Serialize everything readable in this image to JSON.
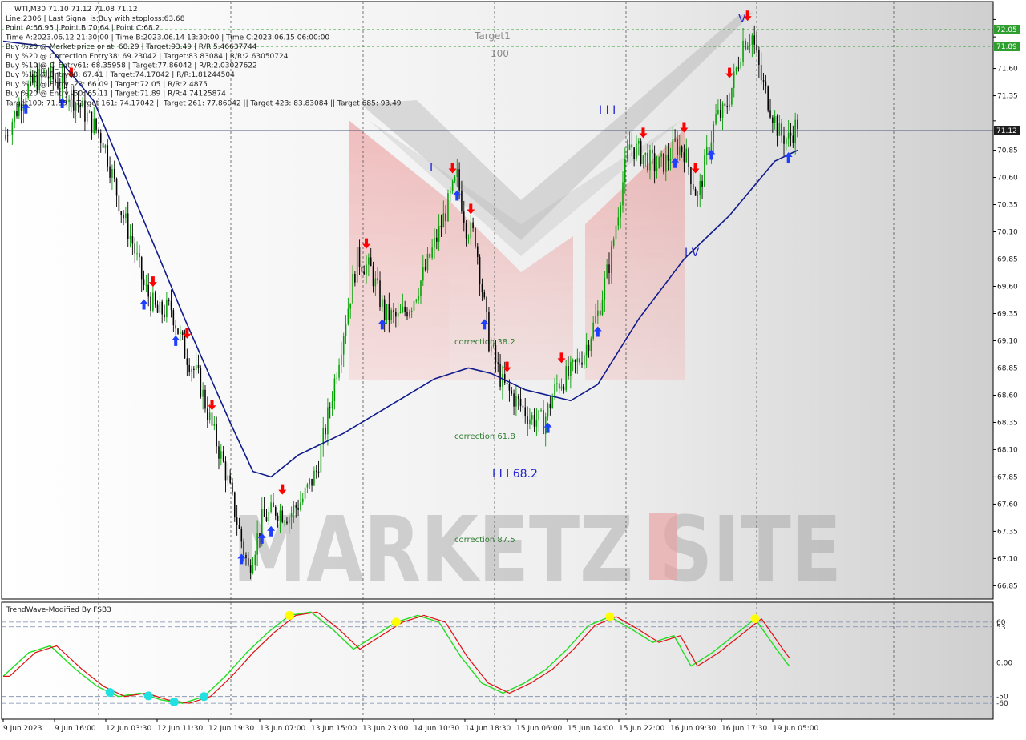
{
  "header": {
    "symbol_line": "WTI,M30  71.10 71.12 71.08 71.12",
    "info_lines": [
      "Line:2306 | Last Signal is:Buy with stoploss:63.68",
      "Point A:66.95 | Point B:70.64 | Point C:68.2",
      "Time A:2023.06.12 21:30:00 | Time B:2023.06.14 13:30:00 | Time C:2023.06.15 06:00:00",
      "Buy %20 @ Market price or at: 68.29 | Target:93.49 | R/R:5.46637744",
      "Buy %20 @ Correction Entry38: 69.23042 | Target:83.83084 | R/R:2.63050724",
      "Buy %10 @ C_Entry61: 68.35958 | Target:77.86042 | R/R:2.03027622",
      "Buy %10 @ Entry88: 67.41 | Target:74.17042 | R/R:1.81244504",
      "Buy %10 @ Entry -23: 66.09 | Target:72.05 | R/R:2.4875",
      "Buy %20 @ Entry -50: 65.11 | Target:71.89 | R/R:4.74125874",
      "Target100: 71.89 || Target 161: 74.17042 || Target 261: 77.86042 || Target 423: 83.83084 || Target 685: 93.49"
    ]
  },
  "annotations": {
    "target_label": "Target1",
    "target_value": "100",
    "corrections": [
      "correction 38.2",
      "correction 61.8",
      "correction 87.5"
    ],
    "wave_labels": [
      "I",
      "I I I",
      "I V",
      "V",
      "I I I 68.2"
    ],
    "watermark": "MARKETZ SITE"
  },
  "price_axis": {
    "ticks": [
      "72.05",
      "71.89",
      "71.60",
      "71.35",
      "71.12",
      "70.85",
      "70.60",
      "70.35",
      "70.10",
      "69.85",
      "69.60",
      "69.35",
      "69.10",
      "68.85",
      "68.60",
      "68.35",
      "68.10",
      "67.85",
      "67.60",
      "67.35",
      "67.10",
      "66.85"
    ],
    "current_price": "71.12",
    "target_tags": [
      "72.05",
      "71.89"
    ]
  },
  "time_axis": {
    "labels": [
      "9 Jun 2023",
      "9 Jun 16:00",
      "12 Jun 03:30",
      "12 Jun 11:30",
      "12 Jun 19:30",
      "13 Jun 07:00",
      "13 Jun 15:00",
      "13 Jun 23:00",
      "14 Jun 10:30",
      "14 Jun 18:30",
      "15 Jun 06:00",
      "15 Jun 14:00",
      "15 Jun 22:00",
      "16 Jun 09:30",
      "16 Jun 17:30",
      "19 Jun 05:00"
    ]
  },
  "indicator": {
    "title": "TrendWave-Modified By FSB3",
    "levels": [
      "60",
      "53",
      "0.00",
      "-50",
      "-60"
    ]
  },
  "colors": {
    "up_candle": "#00a000",
    "down_candle": "#000000",
    "ma_line": "#101c8c",
    "buy_arrow": "#1f3fff",
    "sell_arrow": "#ff0000",
    "target_line": "#2ca02c",
    "osc_green": "#22dd22",
    "osc_red": "#dd1111",
    "osc_yellow_dot": "#ffff00",
    "osc_cyan_dot": "#22e0e0"
  },
  "chart_data": {
    "type": "candlestick",
    "symbol": "WTI",
    "timeframe": "M30",
    "ylim": [
      66.75,
      72.2
    ],
    "price_ticks": [
      72.05,
      71.89,
      71.6,
      71.35,
      71.12,
      70.85,
      70.6,
      70.35,
      70.1,
      69.85,
      69.6,
      69.35,
      69.1,
      68.85,
      68.6,
      68.35,
      68.1,
      67.85,
      67.6,
      67.35,
      67.1,
      66.85
    ],
    "target_levels": [
      72.05,
      71.89
    ],
    "current_price": 71.12,
    "close_path": [
      [
        0,
        70.95
      ],
      [
        10,
        71.4
      ],
      [
        18,
        71.55
      ],
      [
        26,
        71.45
      ],
      [
        34,
        71.25
      ],
      [
        44,
        70.95
      ],
      [
        52,
        70.3
      ],
      [
        57,
        70.0
      ],
      [
        62,
        69.6
      ],
      [
        68,
        69.35
      ],
      [
        74,
        69.4
      ],
      [
        80,
        69.0
      ],
      [
        86,
        68.75
      ],
      [
        92,
        68.3
      ],
      [
        98,
        67.9
      ],
      [
        104,
        67.35
      ],
      [
        108,
        67.0
      ],
      [
        114,
        67.45
      ],
      [
        120,
        67.55
      ],
      [
        126,
        67.5
      ],
      [
        132,
        67.65
      ],
      [
        138,
        67.9
      ],
      [
        144,
        68.5
      ],
      [
        150,
        69.2
      ],
      [
        156,
        69.85
      ],
      [
        162,
        69.75
      ],
      [
        168,
        69.35
      ],
      [
        174,
        69.3
      ],
      [
        180,
        69.45
      ],
      [
        186,
        69.75
      ],
      [
        192,
        70.1
      ],
      [
        196,
        70.35
      ],
      [
        200,
        70.6
      ],
      [
        204,
        70.15
      ],
      [
        208,
        70.05
      ],
      [
        214,
        69.1
      ],
      [
        220,
        68.7
      ],
      [
        226,
        68.55
      ],
      [
        232,
        68.4
      ],
      [
        238,
        68.35
      ],
      [
        244,
        68.7
      ],
      [
        250,
        68.8
      ],
      [
        256,
        69.0
      ],
      [
        262,
        69.35
      ],
      [
        268,
        69.9
      ],
      [
        272,
        70.45
      ],
      [
        276,
        70.9
      ],
      [
        282,
        70.8
      ],
      [
        288,
        70.7
      ],
      [
        292,
        70.75
      ],
      [
        296,
        70.9
      ],
      [
        300,
        70.85
      ],
      [
        306,
        70.4
      ],
      [
        310,
        70.8
      ],
      [
        314,
        71.15
      ],
      [
        318,
        71.2
      ],
      [
        322,
        71.5
      ],
      [
        326,
        71.85
      ],
      [
        330,
        71.9
      ],
      [
        334,
        71.5
      ],
      [
        338,
        71.25
      ],
      [
        342,
        71.0
      ],
      [
        346,
        70.95
      ],
      [
        350,
        71.1
      ]
    ],
    "ma_path": [
      [
        0,
        71.85
      ],
      [
        20,
        71.8
      ],
      [
        40,
        71.3
      ],
      [
        60,
        70.3
      ],
      [
        80,
        69.3
      ],
      [
        100,
        68.35
      ],
      [
        110,
        67.9
      ],
      [
        118,
        67.85
      ],
      [
        130,
        68.05
      ],
      [
        150,
        68.25
      ],
      [
        170,
        68.5
      ],
      [
        190,
        68.75
      ],
      [
        205,
        68.85
      ],
      [
        215,
        68.8
      ],
      [
        230,
        68.65
      ],
      [
        250,
        68.55
      ],
      [
        262,
        68.7
      ],
      [
        280,
        69.3
      ],
      [
        300,
        69.85
      ],
      [
        320,
        70.25
      ],
      [
        340,
        70.75
      ],
      [
        350,
        70.85
      ]
    ],
    "buy_signals": [
      10,
      26,
      62,
      76,
      105,
      114,
      118,
      167,
      200,
      212,
      240,
      262,
      296,
      312,
      346
    ],
    "sell_signals": [
      30,
      66,
      81,
      92,
      123,
      160,
      198,
      206,
      222,
      246,
      282,
      300,
      305,
      320,
      328
    ],
    "point_a": 66.95,
    "point_b": 70.64,
    "point_c": 68.2,
    "oscillator": {
      "ylim": [
        -80,
        80
      ],
      "levels": [
        60,
        53,
        0,
        -50,
        -60
      ],
      "main": [
        [
          0,
          -20
        ],
        [
          12,
          15
        ],
        [
          22,
          25
        ],
        [
          34,
          -10
        ],
        [
          44,
          -35
        ],
        [
          54,
          -50
        ],
        [
          64,
          -45
        ],
        [
          74,
          -55
        ],
        [
          84,
          -60
        ],
        [
          94,
          -50
        ],
        [
          104,
          -20
        ],
        [
          114,
          15
        ],
        [
          124,
          45
        ],
        [
          134,
          70
        ],
        [
          144,
          75
        ],
        [
          154,
          50
        ],
        [
          164,
          20
        ],
        [
          174,
          40
        ],
        [
          184,
          60
        ],
        [
          194,
          70
        ],
        [
          204,
          60
        ],
        [
          214,
          10
        ],
        [
          224,
          -30
        ],
        [
          234,
          -45
        ],
        [
          244,
          -30
        ],
        [
          254,
          -10
        ],
        [
          264,
          20
        ],
        [
          274,
          55
        ],
        [
          284,
          68
        ],
        [
          294,
          50
        ],
        [
          304,
          30
        ],
        [
          314,
          40
        ],
        [
          322,
          -5
        ],
        [
          332,
          15
        ],
        [
          342,
          40
        ],
        [
          352,
          65
        ],
        [
          362,
          20
        ],
        [
          368,
          -5
        ]
      ],
      "yellow_dots": [
        134,
        184,
        284,
        352
      ],
      "cyan_dots": [
        50,
        68,
        80,
        94
      ]
    }
  }
}
